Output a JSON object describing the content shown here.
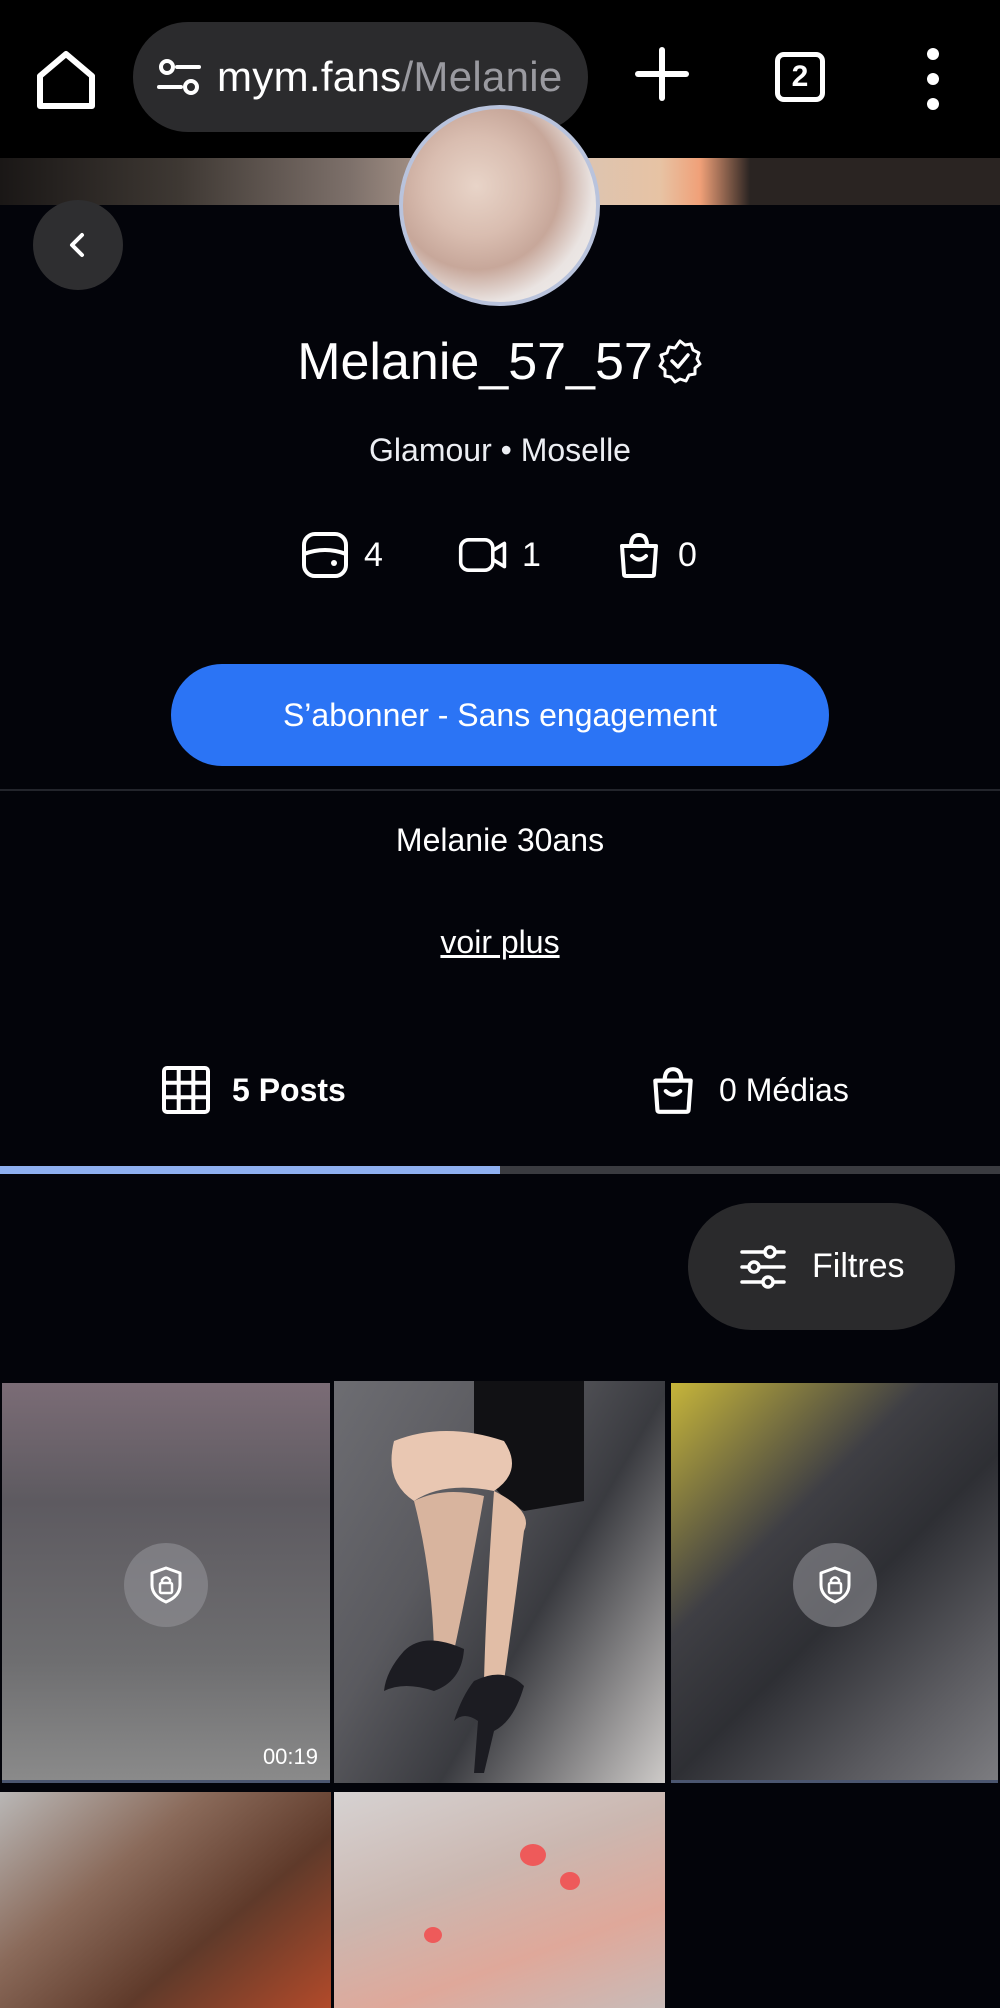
{
  "browser": {
    "url_host": "mym.fans",
    "url_path": "/Melanie",
    "tab_count": "2"
  },
  "profile": {
    "username": "Melanie_57_57",
    "subtitle": "Glamour • Moselle",
    "stats": {
      "photos": "4",
      "videos": "1",
      "products": "0"
    },
    "subscribe_label": "S’abonner - Sans engagement",
    "bio": "Melanie 30ans",
    "see_more": "voir plus"
  },
  "tabs": {
    "posts_label": "5 Posts",
    "medias_label": "0 Médias"
  },
  "filters_label": "Filtres",
  "posts": [
    {
      "locked": true,
      "duration": "00:19"
    },
    {
      "locked": false
    },
    {
      "locked": true
    },
    {
      "locked": false
    },
    {
      "locked": false
    }
  ],
  "colors": {
    "accent_blue": "#2b74f5",
    "tab_indicator": "#8eb0f0",
    "background": "#03040a"
  }
}
